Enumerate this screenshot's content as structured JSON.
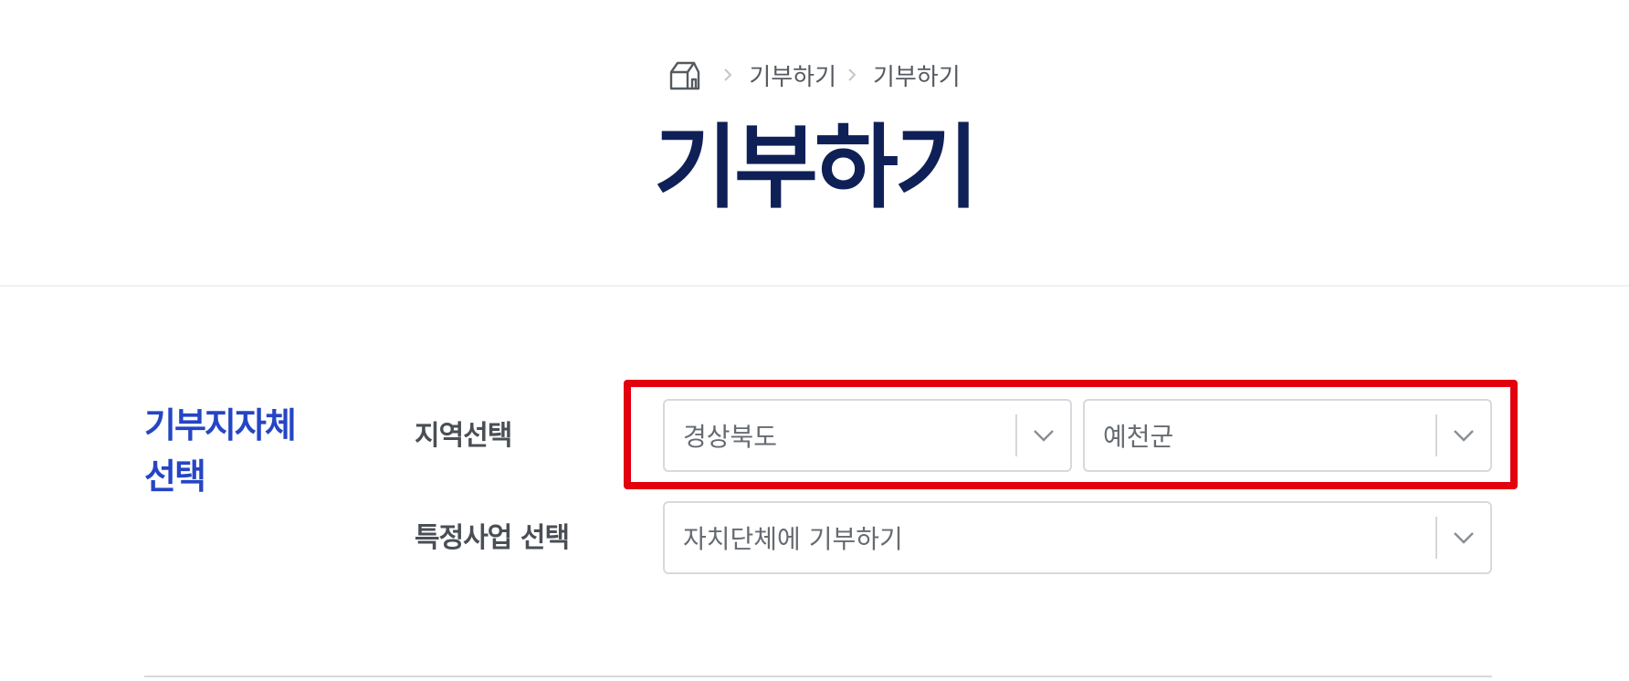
{
  "breadcrumb": {
    "home_icon": "home-icon",
    "items": [
      "기부하기",
      "기부하기"
    ]
  },
  "page": {
    "title": "기부하기"
  },
  "section": {
    "title_line1": "기부지자체",
    "title_line2": "선택"
  },
  "form": {
    "region_label": "지역선택",
    "province_value": "경상북도",
    "county_value": "예천군",
    "project_label": "특정사업 선택",
    "project_value": "자치단체에 기부하기"
  },
  "colors": {
    "title": "#0f2057",
    "section_accent": "#2545c4",
    "highlight": "#e3000f"
  }
}
